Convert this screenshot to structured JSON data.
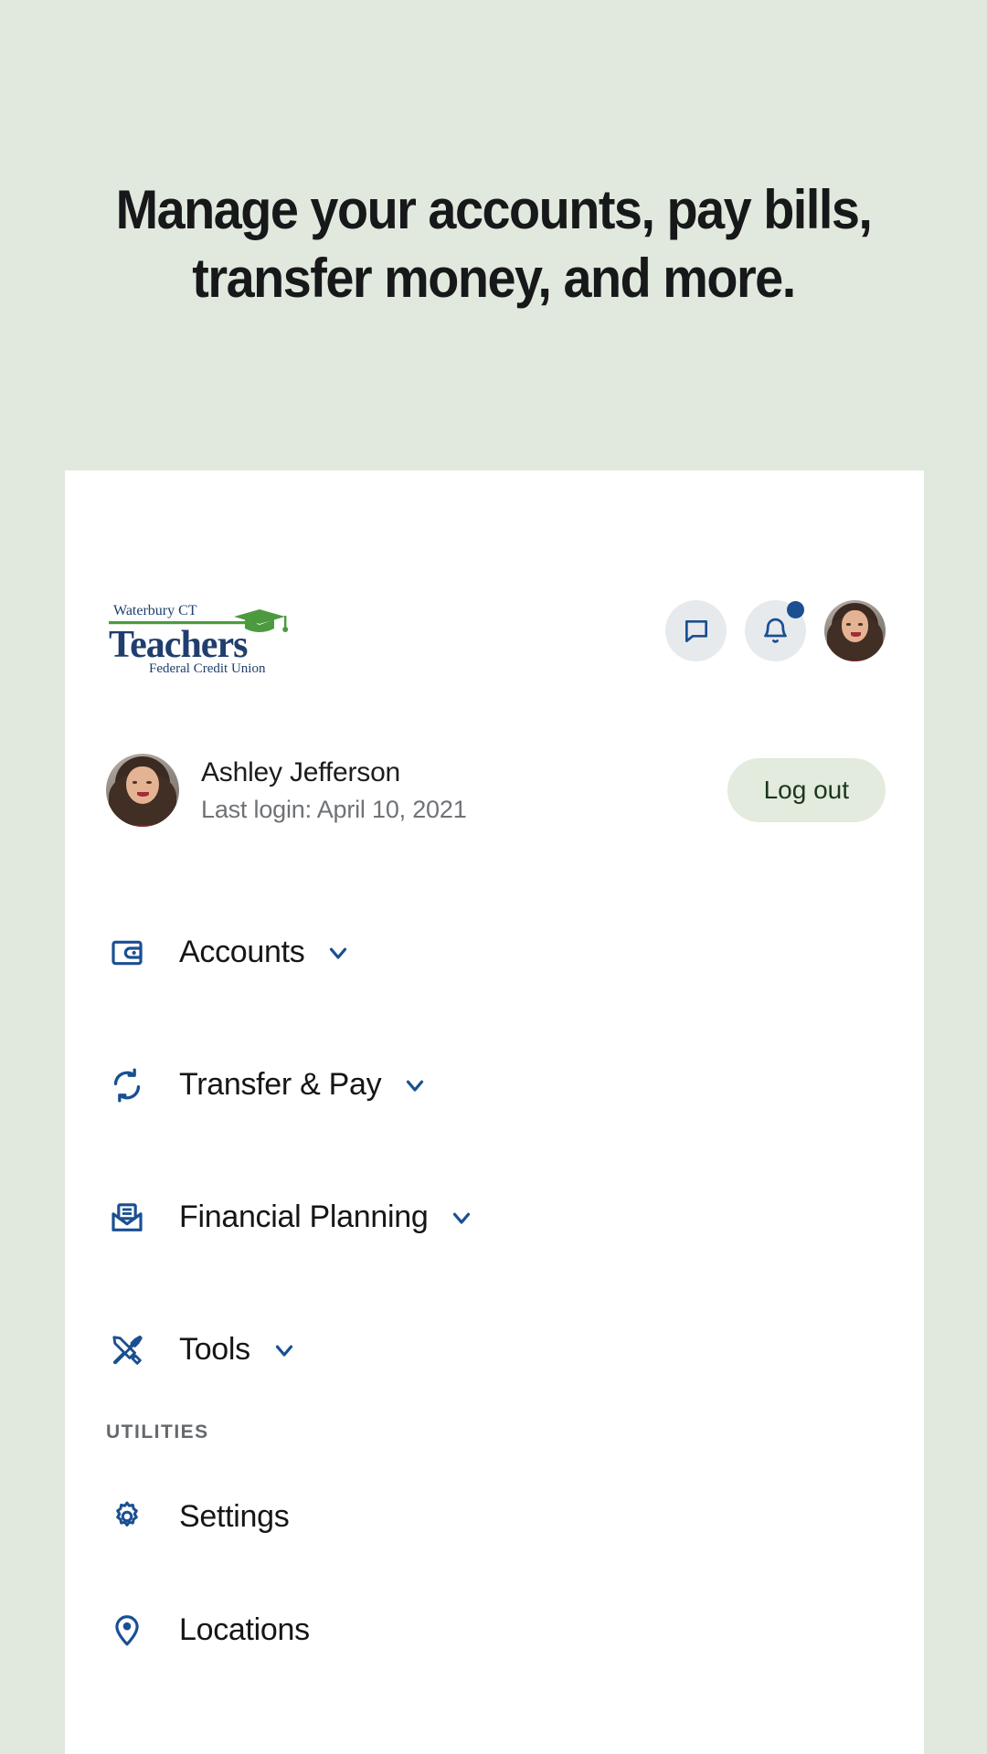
{
  "theme": {
    "page_background": "#e1e8dd",
    "card_background": "#ffffff",
    "brand_blue": "#1a4f92",
    "logo_navy": "#1f3e6e",
    "logo_green": "#4c9a3f",
    "text_primary": "#151618",
    "text_muted": "#6f7276",
    "logout_bg": "#e3eade",
    "logout_text": "#19371c",
    "notification_dot": "#1a4f92"
  },
  "headline": {
    "line1": "Manage your accounts, pay bills,",
    "line2": "transfer money, and more."
  },
  "logo": {
    "top_text": "Waterbury CT",
    "main_text": "Teachers",
    "bottom_text": "Federal Credit Union",
    "cap_icon": "graduation-cap-icon"
  },
  "header": {
    "actions": [
      {
        "name": "messages-button",
        "icon": "chat-bubble-icon",
        "badge": false
      },
      {
        "name": "notifications-button",
        "icon": "bell-icon",
        "badge": true
      }
    ],
    "avatar_alt": "Ashley Jefferson"
  },
  "user": {
    "name": "Ashley Jefferson",
    "last_login": "Last login: April 10, 2021",
    "logout_label": "Log out"
  },
  "nav": {
    "primary": [
      {
        "label": "Accounts",
        "icon": "wallet-icon",
        "chevron": "chevron-down-icon"
      },
      {
        "label": "Transfer & Pay",
        "icon": "transfer-sync-icon",
        "chevron": "chevron-down-icon"
      },
      {
        "label": "Financial Planning",
        "icon": "envelope-document-icon",
        "chevron": "chevron-down-icon"
      },
      {
        "label": "Tools",
        "icon": "hammer-screwdriver-icon",
        "chevron": "chevron-down-icon"
      }
    ],
    "utilities_heading": "UTILITIES",
    "utilities": [
      {
        "label": "Settings",
        "icon": "gear-icon"
      },
      {
        "label": "Locations",
        "icon": "map-pin-icon"
      }
    ]
  }
}
